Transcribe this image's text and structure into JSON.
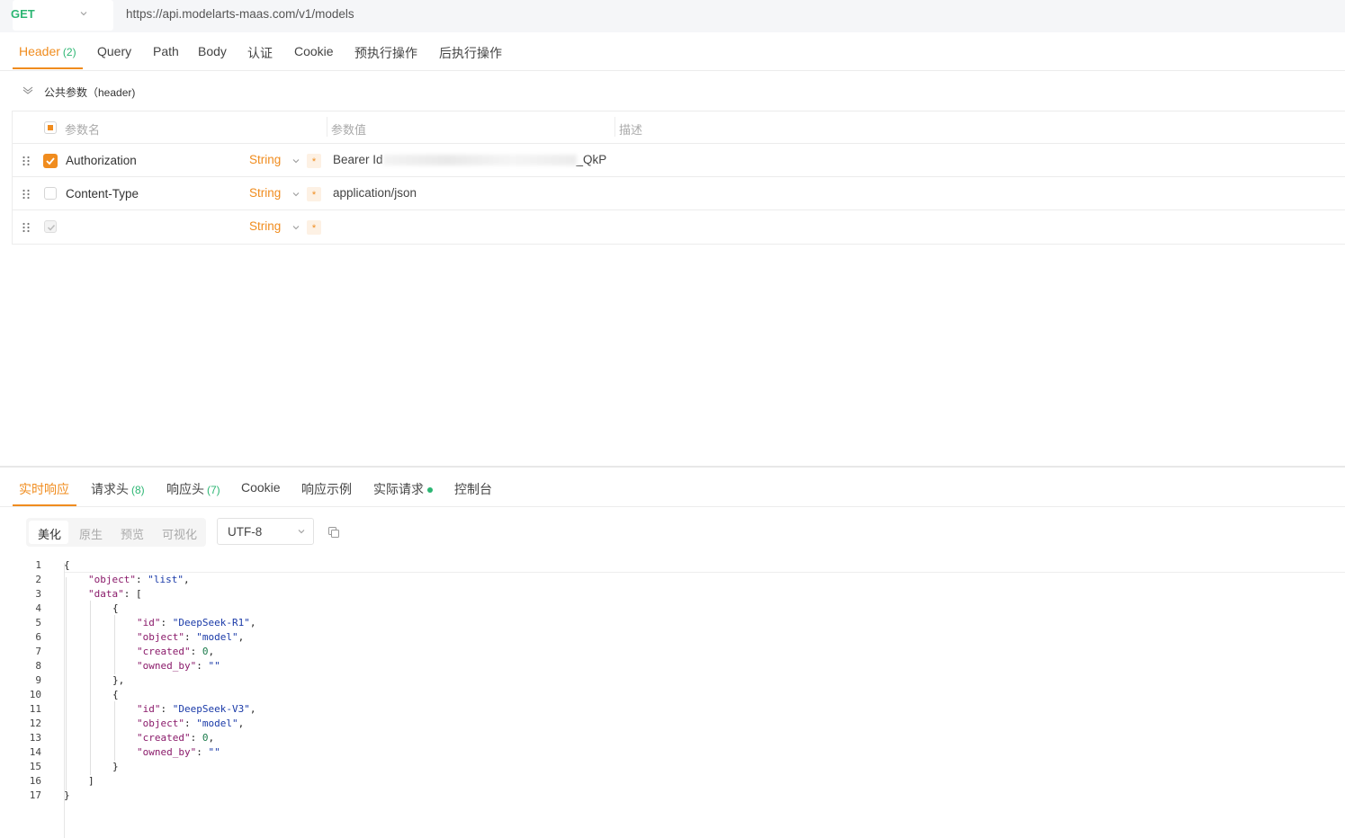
{
  "request": {
    "method": "GET",
    "url": "https://api.modelarts-maas.com/v1/models"
  },
  "request_tabs": [
    {
      "label": "Header",
      "count": "(2)"
    },
    {
      "label": "Query"
    },
    {
      "label": "Path"
    },
    {
      "label": "Body"
    },
    {
      "label": "认证"
    },
    {
      "label": "Cookie"
    },
    {
      "label": "预执行操作"
    },
    {
      "label": "后执行操作"
    }
  ],
  "public_params": {
    "title": "公共参数（header)"
  },
  "param_table": {
    "headers": {
      "name": "参数名",
      "value": "参数值",
      "desc": "描述"
    },
    "rows": [
      {
        "name": "Authorization",
        "type": "String",
        "required": "*",
        "value": "Bearer Id",
        "value_tail": "_QkP",
        "checked": "checked"
      },
      {
        "name": "Content-Type",
        "type": "String",
        "required": "*",
        "value": "application/json",
        "checked": "unchecked"
      },
      {
        "name": "",
        "type": "String",
        "required": "*",
        "value": "",
        "checked": "disabled"
      }
    ]
  },
  "response_tabs": [
    {
      "label": "实时响应"
    },
    {
      "label": "请求头",
      "count": "(8)"
    },
    {
      "label": "响应头",
      "count": "(7)"
    },
    {
      "label": "Cookie"
    },
    {
      "label": "响应示例"
    },
    {
      "label": "实际请求"
    },
    {
      "label": "控制台"
    }
  ],
  "format_tabs": [
    "美化",
    "原生",
    "预览",
    "可视化"
  ],
  "encoding": "UTF-8",
  "code_lines": [
    "1",
    "2",
    "3",
    "4",
    "5",
    "6",
    "7",
    "8",
    "9",
    "10",
    "11",
    "12",
    "13",
    "14",
    "15",
    "16",
    "17"
  ],
  "code": {
    "l1": "{",
    "l2k": "\"object\"",
    "l2v": "\"list\"",
    "l3k": "\"data\"",
    "l3v": "[",
    "l4": "{",
    "l5k": "\"id\"",
    "l5v": "\"DeepSeek-R1\"",
    "l6k": "\"object\"",
    "l6v": "\"model\"",
    "l7k": "\"created\"",
    "l7v": "0",
    "l8k": "\"owned_by\"",
    "l8v": "\"\"",
    "l9": "},",
    "l10": "{",
    "l11k": "\"id\"",
    "l11v": "\"DeepSeek-V3\"",
    "l12k": "\"object\"",
    "l12v": "\"model\"",
    "l13k": "\"created\"",
    "l13v": "0",
    "l14k": "\"owned_by\"",
    "l14v": "\"\"",
    "l15": "}",
    "l16": "]",
    "l17": "}"
  },
  "colors": {
    "accent": "#f08c1e",
    "success": "#2cb673"
  }
}
